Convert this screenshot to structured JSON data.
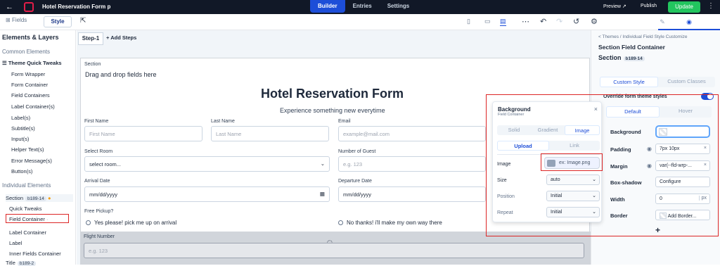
{
  "topbar": {
    "form_title": "Hotel Reservation Form p",
    "tabs": [
      "Builder",
      "Entries",
      "Settings"
    ],
    "preview": "Preview",
    "publish": "Publish",
    "update": "Update"
  },
  "toolbar": {
    "fields": "Fields",
    "style": "Style",
    "add_steps": "Add Steps",
    "step_label": "Step-1"
  },
  "left": {
    "title": "Elements & Layers",
    "common": "Common Elements",
    "theme_tweaks": "Theme Quick Tweaks",
    "common_items": [
      "Form Wrapper",
      "Form Container",
      "Field Containers",
      "Label Container(s)",
      "Label(s)",
      "Subtitle(s)",
      "Input(s)",
      "Helper Text(s)",
      "Error Message(s)",
      "Button(s)"
    ],
    "individual": "Individual Elements",
    "section_label": "Section",
    "section_id": "b189-14",
    "section_items": [
      "Quick Tweaks",
      "Field Container",
      "Label Container",
      "Label",
      "Inner Fields Container"
    ],
    "title_label": "Title",
    "title_id": "b189-2"
  },
  "form": {
    "section": "Section",
    "drag_drop": "Drag and drop fields here",
    "title": "Hotel Reservation Form",
    "subtitle": "Experience something new everytime",
    "first_name_label": "First Name",
    "first_name_ph": "First Name",
    "last_name_label": "Last Name",
    "last_name_ph": "Last Name",
    "email_label": "Email",
    "email_ph": "example@mail.com",
    "room_label": "Select Room",
    "room_value": "select room...",
    "guest_label": "Number of Guest",
    "guest_ph": "e.g. 123",
    "arrival_label": "Arrival Date",
    "arrival_value": "mm/dd/yyyy",
    "departure_label": "Departure Date",
    "departure_value": "mm/dd/yyyy",
    "pickup_label": "Free Pickup?",
    "pickup_yes": "Yes please! pick me up on arrival",
    "pickup_no": "No thanks! i'll make my own way there",
    "flight_label": "Flight Number",
    "flight_ph": "e.g. 123"
  },
  "popup": {
    "title": "Background",
    "subtitle": "Field Container",
    "types": [
      "Solid",
      "Gradient",
      "Image"
    ],
    "sources": [
      "Upload",
      "Link"
    ],
    "image_label": "Image",
    "image_ph": "ex: Image.png",
    "size_label": "Size",
    "size_value": "auto",
    "position_label": "Position",
    "position_value": "Initial",
    "repeat_label": "Repeat",
    "repeat_value": "Initial"
  },
  "right": {
    "breadcrumb": "< Themes / Individual Field Style Customize",
    "title": "Section Field Container",
    "section_label": "Section",
    "section_id": "b189-14",
    "tabs": [
      "Custom Style",
      "Custom Classes"
    ],
    "override": "Override form theme styles",
    "states": [
      "Default",
      "Hover"
    ],
    "background": "Background",
    "padding": "Padding",
    "padding_value": "7px 10px",
    "margin": "Margin",
    "margin_value": "var(--fld-wrp-...",
    "box_shadow": "Box-shadow",
    "box_shadow_value": "Configure",
    "width": "Width",
    "width_value": "0",
    "width_unit": "px",
    "border": "Border",
    "border_value": "Add Border..."
  },
  "colors": {
    "accent": "#1d4ed8",
    "update": "#22c55e",
    "highlight": "#dc2626"
  }
}
